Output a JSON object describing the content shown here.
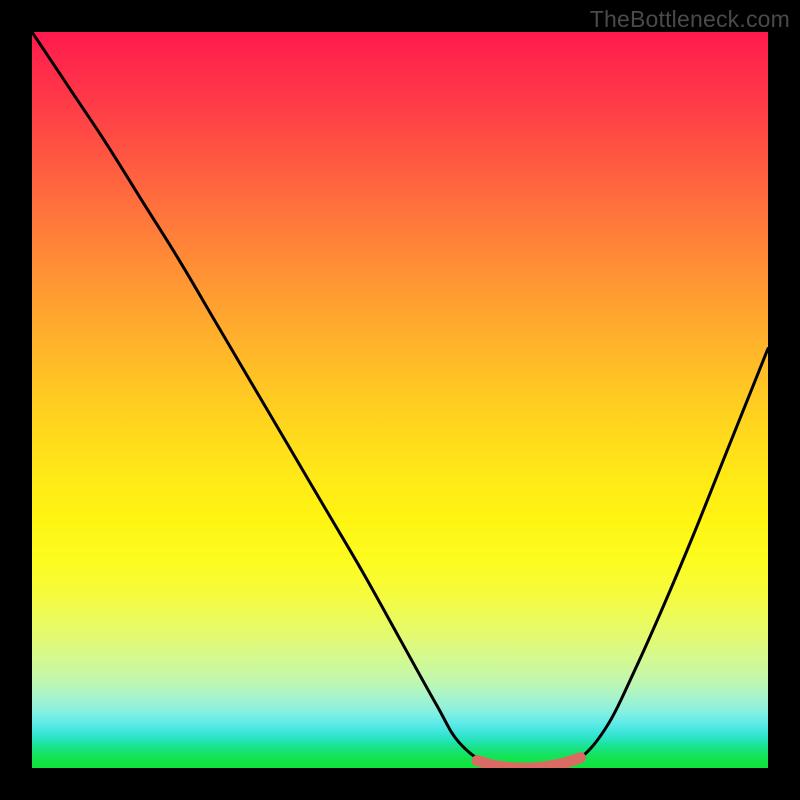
{
  "watermark": "TheBottleneck.com",
  "colors": {
    "frame": "#000000",
    "curve_stroke": "#000000",
    "valley_stroke": "#d96b63",
    "gradient_top": "#ff1a4d",
    "gradient_bottom": "#10e33a"
  },
  "chart_data": {
    "type": "line",
    "title": "",
    "xlabel": "",
    "ylabel": "",
    "xlim": [
      0,
      1
    ],
    "ylim": [
      0,
      1
    ],
    "note": "Axes are unlabeled; values are normalized estimates read from the plot. y=1 at top, y=0 at bottom (green band). The curve is a V shape with its minimum around x≈0.62–0.72, with a short flat valley highlighted in a reddish stroke.",
    "series": [
      {
        "name": "main-curve",
        "x": [
          0.0,
          0.05,
          0.1,
          0.15,
          0.2,
          0.25,
          0.3,
          0.35,
          0.4,
          0.45,
          0.5,
          0.55,
          0.58,
          0.62,
          0.66,
          0.7,
          0.74,
          0.78,
          0.82,
          0.86,
          0.9,
          0.94,
          0.98,
          1.0
        ],
        "y": [
          1.0,
          0.925,
          0.85,
          0.77,
          0.69,
          0.605,
          0.52,
          0.435,
          0.35,
          0.265,
          0.175,
          0.085,
          0.035,
          0.005,
          0.0,
          0.002,
          0.01,
          0.055,
          0.135,
          0.225,
          0.32,
          0.42,
          0.52,
          0.57
        ]
      },
      {
        "name": "valley-highlight",
        "x": [
          0.605,
          0.63,
          0.66,
          0.69,
          0.72,
          0.745
        ],
        "y": [
          0.01,
          0.003,
          0.0,
          0.001,
          0.006,
          0.014
        ]
      }
    ]
  }
}
